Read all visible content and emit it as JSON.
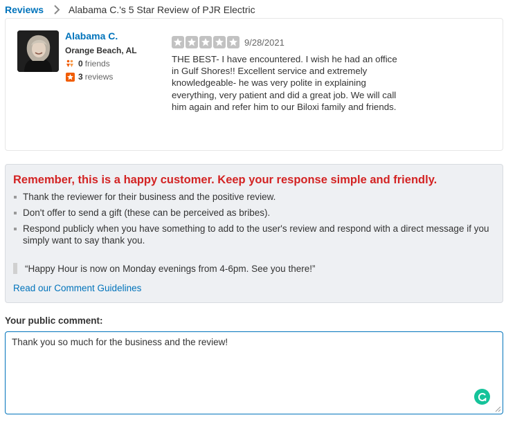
{
  "breadcrumb": {
    "root": "Reviews",
    "current": "Alabama C.'s 5 Star Review of PJR Electric"
  },
  "review": {
    "user": {
      "name": "Alabama C.",
      "location": "Orange Beach, AL",
      "friends_count": "0",
      "friends_label": "friends",
      "reviews_count": "3",
      "reviews_label": "reviews"
    },
    "rating": 5,
    "date": "9/28/2021",
    "text": "THE BEST- I have encountered. I wish he had an office in Gulf Shores!! Excellent service and extremely knowledgeable- he was very polite in explaining everything, very patient and did a great job. We will call him again and refer him to our Biloxi family and friends."
  },
  "tips": {
    "heading": "Remember, this is a happy customer. Keep your response simple and friendly.",
    "items": [
      "Thank the reviewer for their business and the positive review.",
      "Don't offer to send a gift (these can be perceived as bribes).",
      "Respond publicly when you have something to add to the user's review and respond with a direct message if you simply want to say thank you."
    ],
    "example_quote": "“Happy Hour is now on Monday evenings from 4-6pm. See you there!”",
    "guidelines_link": "Read our Comment Guidelines"
  },
  "comment": {
    "label": "Your public comment:",
    "value": "Thank you so much for the business and the review!"
  },
  "colors": {
    "link_blue": "#0073bb",
    "alert_red": "#d32323",
    "star_gray": "#c2c2c2",
    "grammarly_green": "#15c39a",
    "panel_bg": "#eef0f3"
  },
  "icons": {
    "breadcrumb_separator": "chevron-right-icon",
    "friends": "friends-icon",
    "reviews": "review-star-icon",
    "rating": "star-icon",
    "assistant": "grammar-assistant-icon"
  }
}
